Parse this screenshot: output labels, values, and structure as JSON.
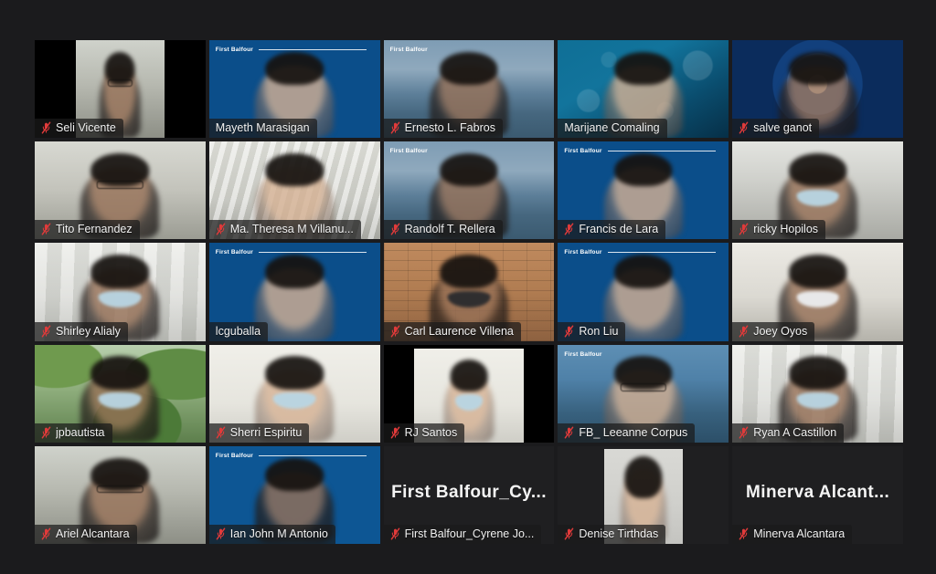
{
  "app": {
    "name": "Zoom Meeting",
    "view": "Gallery View",
    "background_color": "#1b1b1d",
    "active_speaker_border_color": "#e8e83a",
    "nameplate_background": "rgba(26,26,26,0.72)",
    "mute_icon_color": "#e03a3a",
    "brand_watermark": "First Balfour",
    "grid": {
      "columns": 5,
      "rows": 5,
      "tile_count": 25
    }
  },
  "participants": [
    {
      "name": "Seli Vicente",
      "muted": true,
      "speaking": false,
      "video": true,
      "background": "room",
      "watermark": false,
      "row": 1,
      "col": 1,
      "inset": true
    },
    {
      "name": "Mayeth Marasigan",
      "muted": false,
      "speaking": true,
      "video": true,
      "background": "fb",
      "watermark": true,
      "row": 1,
      "col": 2,
      "inset": false
    },
    {
      "name": "Ernesto L. Fabros",
      "muted": true,
      "speaking": false,
      "video": true,
      "background": "sea",
      "watermark": true,
      "row": 1,
      "col": 3,
      "inset": false
    },
    {
      "name": "Marijane Comaling",
      "muted": false,
      "speaking": false,
      "video": true,
      "background": "teal",
      "watermark": false,
      "row": 1,
      "col": 4,
      "inset": false
    },
    {
      "name": "salve ganot",
      "muted": true,
      "speaking": false,
      "video": true,
      "background": "shield",
      "watermark": false,
      "row": 1,
      "col": 5,
      "inset": false
    },
    {
      "name": "Tito Fernandez",
      "muted": true,
      "speaking": false,
      "video": true,
      "background": "room2",
      "watermark": false,
      "row": 2,
      "col": 1,
      "inset": false
    },
    {
      "name": "Ma. Theresa M Villanu...",
      "muted": true,
      "speaking": false,
      "video": true,
      "background": "blinds",
      "watermark": false,
      "row": 2,
      "col": 2,
      "inset": false
    },
    {
      "name": "Randolf T. Rellera",
      "muted": true,
      "speaking": false,
      "video": true,
      "background": "sea",
      "watermark": true,
      "row": 2,
      "col": 3,
      "inset": false
    },
    {
      "name": "Francis de Lara",
      "muted": true,
      "speaking": false,
      "video": true,
      "background": "fb",
      "watermark": true,
      "row": 2,
      "col": 4,
      "inset": false
    },
    {
      "name": "ricky Hopilos",
      "muted": true,
      "speaking": false,
      "video": true,
      "background": "office",
      "watermark": false,
      "row": 2,
      "col": 5,
      "inset": false
    },
    {
      "name": "Shirley Alialy",
      "muted": true,
      "speaking": false,
      "video": true,
      "background": "ceiling",
      "watermark": false,
      "row": 3,
      "col": 1,
      "inset": false
    },
    {
      "name": "lcguballa",
      "muted": false,
      "speaking": false,
      "video": true,
      "background": "fb",
      "watermark": true,
      "row": 3,
      "col": 2,
      "inset": false
    },
    {
      "name": "Carl Laurence Villena",
      "muted": true,
      "speaking": false,
      "video": true,
      "background": "brick",
      "watermark": false,
      "row": 3,
      "col": 3,
      "inset": false
    },
    {
      "name": "Ron Liu",
      "muted": true,
      "speaking": false,
      "video": true,
      "background": "fb",
      "watermark": true,
      "row": 3,
      "col": 4,
      "inset": false
    },
    {
      "name": "Joey Oyos",
      "muted": true,
      "speaking": false,
      "video": true,
      "background": "office2",
      "watermark": false,
      "row": 3,
      "col": 5,
      "inset": false
    },
    {
      "name": "jpbautista",
      "muted": true,
      "speaking": false,
      "video": true,
      "background": "palm",
      "watermark": false,
      "row": 4,
      "col": 1,
      "inset": false
    },
    {
      "name": "Sherri Espiritu",
      "muted": true,
      "speaking": false,
      "video": true,
      "background": "whiteroom",
      "watermark": false,
      "row": 4,
      "col": 2,
      "inset": false
    },
    {
      "name": "RJ Santos",
      "muted": true,
      "speaking": false,
      "video": true,
      "background": "whiteroom",
      "watermark": false,
      "row": 4,
      "col": 3,
      "inset": true
    },
    {
      "name": "FB_ Leeanne Corpus",
      "muted": true,
      "speaking": false,
      "video": true,
      "background": "sea2",
      "watermark": true,
      "row": 4,
      "col": 4,
      "inset": false
    },
    {
      "name": "Ryan A Castillon",
      "muted": true,
      "speaking": false,
      "video": true,
      "background": "ceiling",
      "watermark": false,
      "row": 4,
      "col": 5,
      "inset": false
    },
    {
      "name": "Ariel Alcantara",
      "muted": true,
      "speaking": false,
      "video": true,
      "background": "room",
      "watermark": false,
      "row": 5,
      "col": 1,
      "inset": false
    },
    {
      "name": "Ian John M Antonio",
      "muted": true,
      "speaking": false,
      "video": true,
      "background": "fb2",
      "watermark": true,
      "row": 5,
      "col": 2,
      "inset": false
    },
    {
      "name": "First Balfour_Cyrene Jo...",
      "display_name": "First  Balfour_Cy...",
      "muted": true,
      "speaking": false,
      "video": false,
      "background": "none",
      "watermark": false,
      "row": 5,
      "col": 3,
      "inset": false
    },
    {
      "name": "Denise Tirthdas",
      "muted": true,
      "speaking": false,
      "video": false,
      "background": "none",
      "photo": true,
      "watermark": false,
      "row": 5,
      "col": 4,
      "inset": false
    },
    {
      "name": "Minerva Alcantara",
      "display_name": "Minerva  Alcant...",
      "muted": true,
      "speaking": false,
      "video": false,
      "background": "none",
      "watermark": false,
      "row": 5,
      "col": 5,
      "inset": false
    }
  ]
}
